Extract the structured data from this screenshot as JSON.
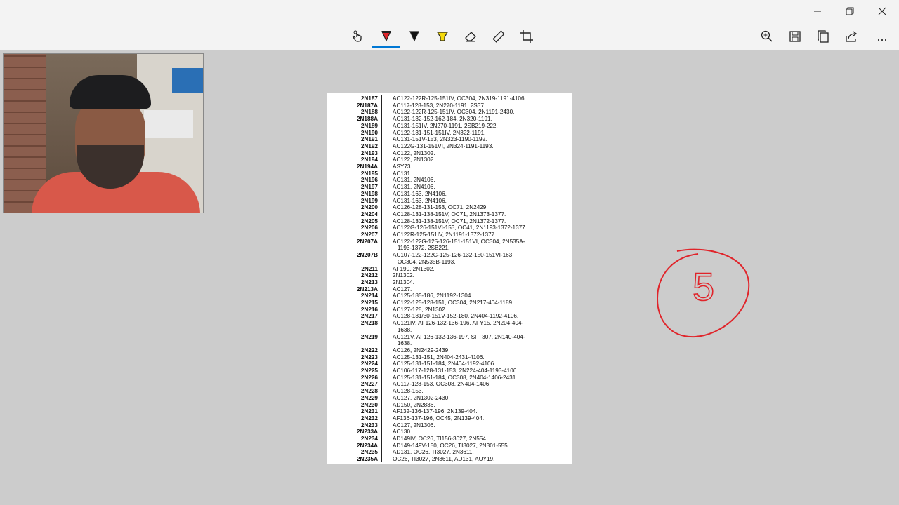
{
  "window": {
    "minimize_icon": "minimize-icon",
    "restore_icon": "restore-icon",
    "close_icon": "close-icon"
  },
  "toolbar": {
    "tools": [
      {
        "name": "touch-writing",
        "icon": "touch-hand-icon"
      },
      {
        "name": "ballpoint-pen",
        "icon": "pen-red-icon",
        "active": true
      },
      {
        "name": "pencil",
        "icon": "pen-black-icon"
      },
      {
        "name": "highlighter",
        "icon": "highlighter-icon"
      },
      {
        "name": "eraser",
        "icon": "eraser-icon"
      },
      {
        "name": "ruler",
        "icon": "ruler-icon"
      },
      {
        "name": "crop",
        "icon": "crop-icon"
      }
    ],
    "right_tools": [
      {
        "name": "zoom",
        "icon": "zoom-icon"
      },
      {
        "name": "save",
        "icon": "save-icon"
      },
      {
        "name": "copy",
        "icon": "copy-icon"
      },
      {
        "name": "share",
        "icon": "share-icon"
      },
      {
        "name": "more",
        "icon": "more-icon",
        "label": "..."
      }
    ],
    "accent": "#0078d4"
  },
  "annotation": {
    "number": "5",
    "color": "#e0242a"
  },
  "document": {
    "rows": [
      {
        "code": "2N187",
        "desc": "AC122-122R-125-151IV, OC304, 2N319-1191-4106."
      },
      {
        "code": "2N187A",
        "desc": "AC117-128-153, 2N270-1191, 2S37."
      },
      {
        "code": "2N188",
        "desc": "AC122-122R-125-151IV, OC304, 2N1191-2430."
      },
      {
        "code": "2N188A",
        "desc": "AC131-132-152-162-184, 2N320-1191."
      },
      {
        "code": "2N189",
        "desc": "AC131-151IV, 2N270-1191, 2SB219-222."
      },
      {
        "code": "2N190",
        "desc": "AC122-131-151-151IV, 2N322-1191."
      },
      {
        "code": "2N191",
        "desc": "AC131-151V-153, 2N323-1190-1192."
      },
      {
        "code": "2N192",
        "desc": "AC122G-131-151VI, 2N324-1191-1193."
      },
      {
        "code": "2N193",
        "desc": "AC122, 2N1302."
      },
      {
        "code": "2N194",
        "desc": "AC122, 2N1302."
      },
      {
        "code": "2N194A",
        "desc": "ASY73."
      },
      {
        "code": "2N195",
        "desc": "AC131."
      },
      {
        "code": "2N196",
        "desc": "AC131, 2N4106."
      },
      {
        "code": "2N197",
        "desc": "AC131, 2N4106."
      },
      {
        "code": "2N198",
        "desc": "AC131-163, 2N4106."
      },
      {
        "code": "2N199",
        "desc": "AC131-163, 2N4106."
      },
      {
        "code": "2N200",
        "desc": "AC126-128-131-153, OC71, 2N2429."
      },
      {
        "code": "2N204",
        "desc": "AC128-131-138-151V, OC71, 2N1373-1377."
      },
      {
        "code": "2N205",
        "desc": "AC128-131-138-151V, OC71, 2N1372-1377."
      },
      {
        "code": "2N206",
        "desc": "AC122G-126-151VI-153, OC41, 2N1193-1372-1377."
      },
      {
        "code": "2N207",
        "desc": "AC122R-125-151IV, 2N1191-1372-1377."
      },
      {
        "code": "2N207A",
        "desc": "AC122-122G-125-126-151-151VI, OC304, 2N535A-\n   1193-1372, 2SB221."
      },
      {
        "code": "2N207B",
        "desc": "AC107-122-122G-125-126-132-150-151VI-163,\n   OC304, 2N535B-1193."
      },
      {
        "code": "2N211",
        "desc": "AF190, 2N1302."
      },
      {
        "code": "2N212",
        "desc": "2N1302."
      },
      {
        "code": "2N213",
        "desc": "2N1304."
      },
      {
        "code": "2N213A",
        "desc": "AC127."
      },
      {
        "code": "2N214",
        "desc": "AC125-185-186, 2N1192-1304."
      },
      {
        "code": "2N215",
        "desc": "AC122-125-128-151, OC304, 2N217-404-1189."
      },
      {
        "code": "2N216",
        "desc": "AC127-128, 2N1302."
      },
      {
        "code": "2N217",
        "desc": "AC128-131/30-151V-152-180, 2N404-1192-4106."
      },
      {
        "code": "2N218",
        "desc": "AC121IV, AF126-132-136-196, AFY15, 2N204-404-\n   1638."
      },
      {
        "code": "2N219",
        "desc": "AC121V, AF126-132-136-197, SFT307, 2N140-404-\n   1638."
      },
      {
        "code": "2N222",
        "desc": "AC126, 2N2429-2439."
      },
      {
        "code": "2N223",
        "desc": "AC125-131-151, 2N404-2431-4106."
      },
      {
        "code": "2N224",
        "desc": "AC125-131-151-184, 2N404-1192-4106."
      },
      {
        "code": "2N225",
        "desc": "AC106-117-128-131-153, 2N224-404-1193-4106."
      },
      {
        "code": "2N226",
        "desc": "AC125-131-151-184, OC308, 2N404-1406-2431."
      },
      {
        "code": "2N227",
        "desc": "AC117-128-153, OC308, 2N404-1406."
      },
      {
        "code": "2N228",
        "desc": "AC128-153."
      },
      {
        "code": "2N229",
        "desc": "AC127, 2N1302-2430."
      },
      {
        "code": "2N230",
        "desc": "AD150, 2N2836."
      },
      {
        "code": "2N231",
        "desc": "AF132-136-137-196, 2N139-404."
      },
      {
        "code": "2N232",
        "desc": "AF136-137-196, OC45, 2N139-404."
      },
      {
        "code": "2N233",
        "desc": "AC127, 2N1306."
      },
      {
        "code": "2N233A",
        "desc": "AC130."
      },
      {
        "code": "2N234",
        "desc": "AD149IV, OC26, TI156-3027, 2N554."
      },
      {
        "code": "2N234A",
        "desc": "AD149-149V-150, OC26, TI3027, 2N301-555."
      },
      {
        "code": "2N235",
        "desc": "AD131, OC26, TI3027, 2N3611."
      },
      {
        "code": "2N235A",
        "desc": "OC26, TI3027, 2N3611, AD131, AUY19."
      }
    ]
  }
}
